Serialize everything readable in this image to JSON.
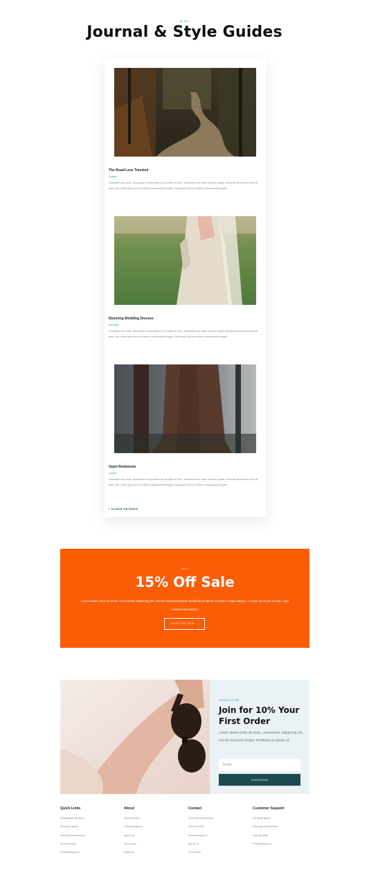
{
  "header": {
    "eyebrow": "BLOG",
    "title": "Journal & Style Guides"
  },
  "posts": [
    {
      "title": "The Road Less Traveled",
      "category": "Guides",
      "excerpt": "Curabitur arcu erat, accumsan id imperdiet et, porttitor at sem. Vestibulum ac diam sit amet quam vehicula elementum sed sit amet dui. Nulla quis lorem ut libero malesuada feugiat. Nulla quis lorem ut libero malesuada feugiat."
    },
    {
      "title": "Stunning Wedding Dresses",
      "category": "Wedding",
      "excerpt": "Curabitur arcu erat, accumsan id imperdiet et, porttitor at sem. Vestibulum ac diam sit amet quam vehicula elementum sed sit amet dui. Nulla quis lorem ut libero malesuada feugiat. Nulla quis lorem ut libero malesuada feugiat."
    },
    {
      "title": "Giant Redwoods",
      "category": "Guides",
      "excerpt": "Curabitur arcu erat, accumsan id imperdiet et, porttitor at sem. Vestibulum ac diam sit amet quam vehicula elementum sed sit amet dui. Nulla quis lorem ut libero malesuada feugiat. Nulla quis lorem ut libero malesuada feugiat."
    }
  ],
  "pagination": {
    "older_label": "« OLDER ENTRIES"
  },
  "sale": {
    "eyebrow": "SALE",
    "title": "15% Off Sale",
    "text": "Lorem ipsum dolor sit amet, consectetur adipiscing elit, sed do eiusmod tempor incididunt ut labore et dolore magna aliqua. Ut enim ad minim veniam, quis nostrud exercitation.",
    "button_label": "SHOP THIS SALE →",
    "bg_color": "#fb5c06"
  },
  "newsletter": {
    "eyebrow": "NEWSLETTER",
    "title": "Join for 10% Your First Order",
    "text": "Lorem ipsum dolor sit amet, consectetur adipiscing elit, sed do eiusmod tempor incididunt ut labore et.",
    "email_placeholder": "Email",
    "button_label": "SUBSCRIBE",
    "button_color": "#1c4a4f"
  },
  "footer": {
    "columns": [
      {
        "title": "Quick Links",
        "links": [
          "Vestibulum ac diam",
          "Sit amet quam",
          "Vehicula elementum",
          "Sed sit amet",
          "Pellentesque in"
        ]
      },
      {
        "title": "About",
        "links": [
          "Sed sit amet",
          "Pellentesque in",
          "Ipsum id",
          "Orci porta",
          "Dapibus"
        ]
      },
      {
        "title": "Contact",
        "links": [
          "Vehicula elementum",
          "Sed sit amet",
          "Pellentesque in",
          "Ipsum id",
          "Orci porta"
        ]
      },
      {
        "title": "Customer Support",
        "links": [
          "Sit amet quam",
          "Vehicula elementum",
          "Sed sit amet",
          "Pellentesque in"
        ]
      }
    ]
  },
  "theme": {
    "accent": "#2a9bb0",
    "dark_teal": "#1c4a4f"
  }
}
